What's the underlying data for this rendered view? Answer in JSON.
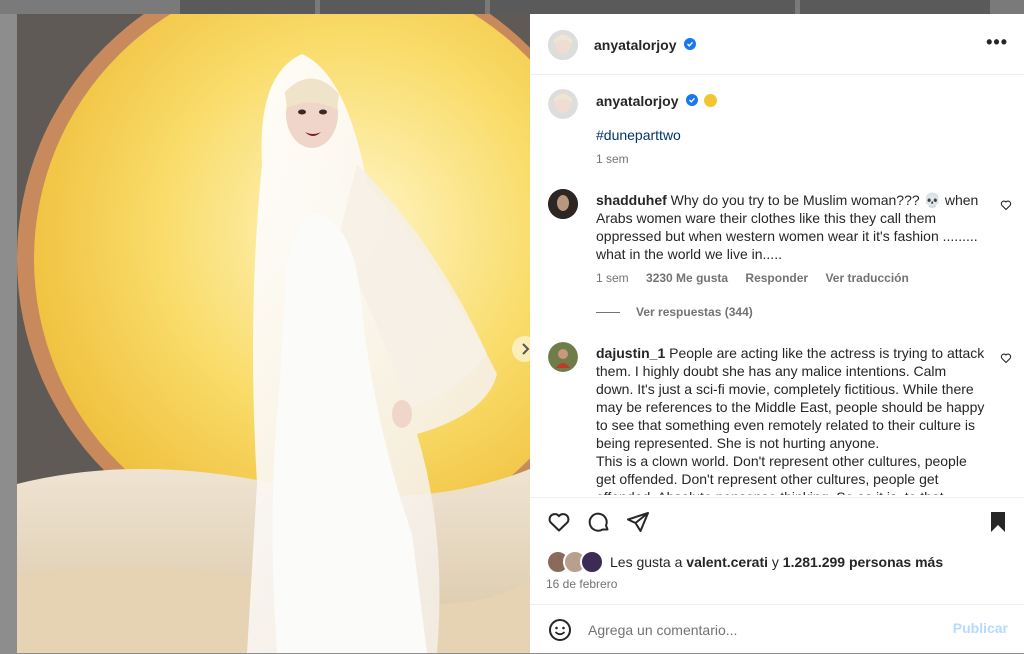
{
  "post": {
    "username": "anyatalorjoy",
    "caption_username": "anyatalorjoy",
    "hashtag": "#duneparttwo",
    "caption_time": "1 sem",
    "date": "16 de febrero",
    "likes": {
      "prefix": "Les gusta a",
      "user": "valent.cerati",
      "connector": "y",
      "count_text": "1.281.299 personas más"
    }
  },
  "comments": [
    {
      "username": "shadduhef",
      "text": "Why do you try to be Muslim woman??? 💀 when Arabs women ware their clothes like this they call them oppressed but when western women wear it it's fashion ......... what in the world we live in.....",
      "time": "1 sem",
      "likes": "3230 Me gusta",
      "reply": "Responder",
      "translate": "Ver traducción",
      "view_replies": "Ver respuestas (344)"
    },
    {
      "username": "dajustin_1",
      "text": "People are acting like the actress is trying to attack them. I highly doubt she has any malice intentions. Calm down. It's just a sci-fi movie, completely fictitious. While there may be references to the Middle East, people should be happy to see that something even remotely related to their culture is being represented. She is not hurting anyone.",
      "text2": "This is a clown world. Don't represent other cultures, people get offended. Don't represent other cultures, people get offended. Absolute nonsense thinking. So as it is, to that"
    }
  ],
  "composer": {
    "placeholder": "Agrega un comentario...",
    "publish": "Publicar"
  },
  "icons": [
    "more-icon",
    "verified-icon",
    "heart-icon",
    "comment-icon",
    "share-icon",
    "bookmark-icon",
    "emoji-icon",
    "chevron-right-icon"
  ],
  "colors": {
    "link": "#00376b",
    "verified": "#1877f2",
    "muted": "#737373",
    "publish_disabled": "#b3dbff"
  }
}
